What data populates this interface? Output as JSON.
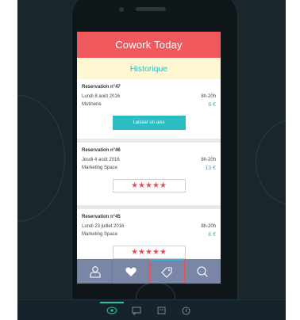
{
  "app": {
    "title": "Cowork Today",
    "section_title": "Historique"
  },
  "reservations": [
    {
      "title": "Reservation n°47",
      "date": "Lundi 8 août 2016",
      "hours": "8h-20h",
      "place": "Mutinerie",
      "price": "8 €",
      "action_label": "Laisser un avis"
    },
    {
      "title": "Reservation n°46",
      "date": "Jeudi 4 août 2016",
      "hours": "8h-20h",
      "place": "Marketing Space",
      "price": "13 €",
      "rating_stars": "★★★★★",
      "rating": 5
    },
    {
      "title": "Reservation n°45",
      "date": "Lundi 23 juillet 2016",
      "hours": "8h-20h",
      "place": "Marketing Space",
      "price": "8 €",
      "rating_stars": "★★★★★",
      "rating": 5
    }
  ],
  "tabbar": {
    "items": [
      {
        "icon": "user-icon"
      },
      {
        "icon": "heart-icon"
      },
      {
        "icon": "tag-icon"
      },
      {
        "icon": "search-icon"
      }
    ]
  },
  "bottom_bar": {
    "items": [
      {
        "icon": "eye-icon"
      },
      {
        "icon": "comment-icon"
      },
      {
        "icon": "message-icon"
      },
      {
        "icon": "clock-icon"
      }
    ]
  },
  "colors": {
    "header": "#f0595d",
    "subheader": "#fdf8d2",
    "accent": "#2bbcc4",
    "stars": "#e94d52",
    "tabbar": "#7a86a6",
    "background": "#19262c"
  }
}
